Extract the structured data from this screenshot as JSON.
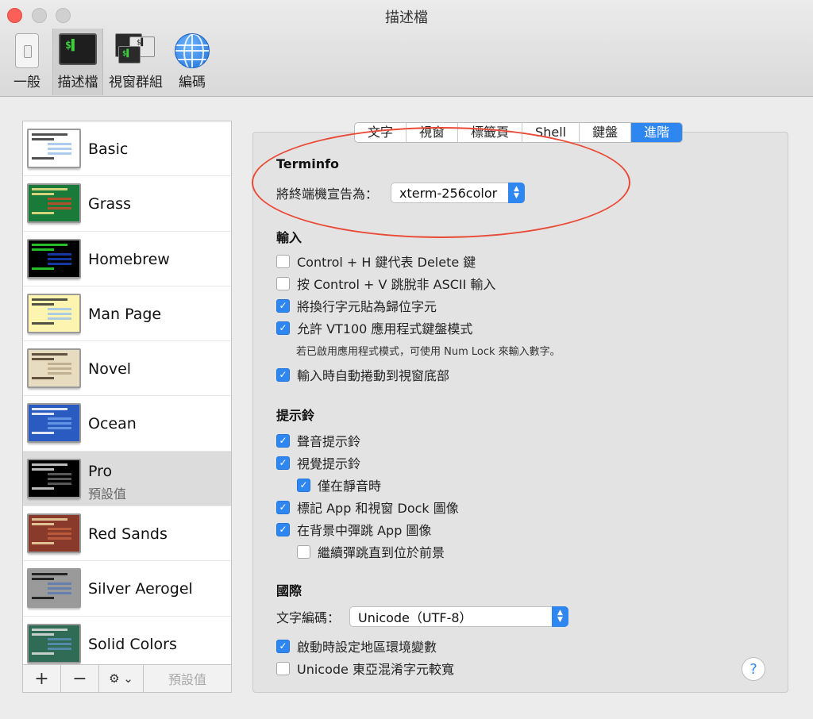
{
  "window": {
    "title": "描述檔"
  },
  "toolbar": {
    "items": [
      {
        "label": "一般",
        "icon": "general-icon"
      },
      {
        "label": "描述檔",
        "icon": "profiles-icon",
        "selected": true
      },
      {
        "label": "視窗群組",
        "icon": "window-groups-icon"
      },
      {
        "label": "編碼",
        "icon": "globe-icon"
      }
    ],
    "profiles_glyph": "$▌",
    "groups_glyph_1": "$▌",
    "groups_glyph_2": "$▌"
  },
  "profiles": {
    "items": [
      {
        "name": "Basic",
        "bg": "#ffffff",
        "fg": "#333333",
        "hl": "#9fc4ea"
      },
      {
        "name": "Grass",
        "bg": "#1a7a3a",
        "fg": "#f4e28a",
        "hl": "#c84b2a"
      },
      {
        "name": "Homebrew",
        "bg": "#000000",
        "fg": "#2ee02e",
        "hl": "#1a3fbf"
      },
      {
        "name": "Man Page",
        "bg": "#fdf4b0",
        "fg": "#333333",
        "hl": "#9fc4ea"
      },
      {
        "name": "Novel",
        "bg": "#e7dcc0",
        "fg": "#4a3b2a",
        "hl": "#b8a88a"
      },
      {
        "name": "Ocean",
        "bg": "#2a5bc0",
        "fg": "#ffffff",
        "hl": "#6fa0e8"
      },
      {
        "name": "Pro",
        "sub": "預設值",
        "bg": "#000000",
        "fg": "#dddddd",
        "hl": "#666666",
        "selected": true
      },
      {
        "name": "Red Sands",
        "bg": "#8a3a2a",
        "fg": "#f0d8a8",
        "hl": "#c06040"
      },
      {
        "name": "Silver Aerogel",
        "bg": "#9a9a9a",
        "fg": "#111111",
        "hl": "#5d7ab0"
      },
      {
        "name": "Solid Colors",
        "bg": "#2f6b55",
        "fg": "#e0e0e0",
        "hl": "#5a8fb8"
      }
    ],
    "footer": {
      "add": "+",
      "remove": "−",
      "gear": "⚙︎ ⌄",
      "default_label": "預設值"
    }
  },
  "tabs": [
    "文字",
    "視窗",
    "標籤頁",
    "Shell",
    "鍵盤",
    "進階"
  ],
  "active_tab": "進階",
  "terminfo": {
    "title": "Terminfo",
    "declare_label": "將終端機宣告為：",
    "declare_value": "xterm-256color"
  },
  "input": {
    "title": "輸入",
    "options": [
      {
        "label": "Control + H 鍵代表 Delete 鍵",
        "checked": false
      },
      {
        "label": "按 Control + V 跳脫非 ASCII 輸入",
        "checked": false
      },
      {
        "label": "將換行字元貼為歸位字元",
        "checked": true
      },
      {
        "label": "允許 VT100 應用程式鍵盤模式",
        "checked": true
      }
    ],
    "note": "若已啟用應用程式模式，可使用 Num Lock 來輸入數字。",
    "scroll_option": {
      "label": "輸入時自動捲動到視窗底部",
      "checked": true
    }
  },
  "bell": {
    "title": "提示鈴",
    "options": [
      {
        "label": "聲音提示鈴",
        "checked": true
      },
      {
        "label": "視覺提示鈴",
        "checked": true
      },
      {
        "label": "僅在靜音時",
        "checked": true,
        "indent": true
      },
      {
        "label": "標記 App 和視窗 Dock 圖像",
        "checked": true
      },
      {
        "label": "在背景中彈跳 App 圖像",
        "checked": true
      },
      {
        "label": "繼續彈跳直到位於前景",
        "checked": false,
        "indent": true
      }
    ]
  },
  "international": {
    "title": "國際",
    "encoding_label": "文字編碼：",
    "encoding_value": "Unicode（UTF-8）",
    "options": [
      {
        "label": "啟動時設定地區環境變數",
        "checked": true
      },
      {
        "label": "Unicode 東亞混淆字元較寬",
        "checked": false
      }
    ]
  },
  "help": {
    "label": "?"
  },
  "colors": {
    "accent": "#2e86f0",
    "annotation": "#ea4a35"
  }
}
